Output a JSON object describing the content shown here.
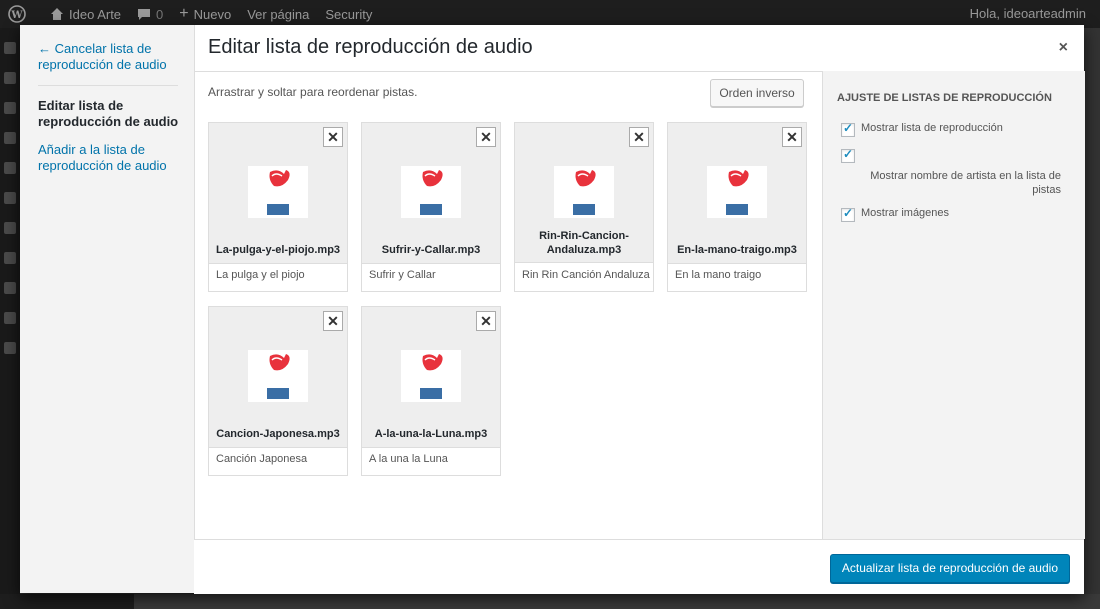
{
  "adminbar": {
    "site": "Ideo Arte",
    "comments": "0",
    "new": "Nuevo",
    "view": "Ver página",
    "security": "Security",
    "greeting": "Hola, ideoarteadmin"
  },
  "menu": {
    "cancel": "← Cancelar lista de reproducción de audio",
    "active": "Editar lista de reproducción de audio",
    "add": "Añadir a la lista de reproducción de audio"
  },
  "title": "Editar lista de reproducción de audio",
  "close": "×",
  "instructions": "Arrastrar y soltar para reordenar pistas.",
  "reverse_button": "Orden inverso",
  "logo_text": "IDEO ARTE",
  "tracks": [
    {
      "file": "La-pulga-y-el-piojo.mp3",
      "caption": "La pulga y el piojo"
    },
    {
      "file": "Sufrir-y-Callar.mp3",
      "caption": "Sufrir y Callar"
    },
    {
      "file": "Rin-Rin-Cancion-Andaluza.mp3",
      "caption": "Rin Rin Canción Andaluza"
    },
    {
      "file": "En-la-mano-traigo.mp3",
      "caption": "En la mano traigo"
    },
    {
      "file": "Cancion-Japonesa.mp3",
      "caption": "Canción Japonesa"
    },
    {
      "file": "A-la-una-la-Luna.mp3",
      "caption": "A la una la Luna"
    }
  ],
  "settings": {
    "heading": "AJUSTE DE LISTAS DE REPRODUCCIÓN",
    "show_playlist": "Mostrar lista de reproducción",
    "show_artist": "Mostrar nombre de artista en la lista de pistas",
    "show_images": "Mostrar imágenes"
  },
  "update_button": "Actualizar lista de reproducción de audio"
}
